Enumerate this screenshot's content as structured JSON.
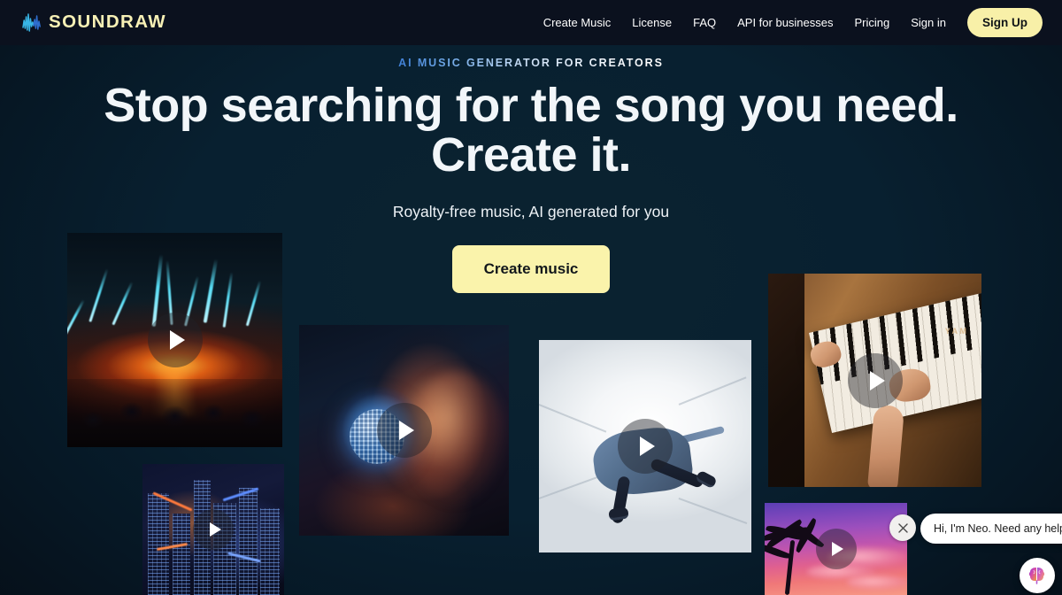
{
  "header": {
    "logo_text": "SOUNDRAW",
    "logo_icon": "waveform-icon",
    "nav": [
      {
        "label": "Create Music"
      },
      {
        "label": "License"
      },
      {
        "label": "FAQ"
      },
      {
        "label": "API for businesses"
      },
      {
        "label": "Pricing"
      },
      {
        "label": "Sign in"
      }
    ],
    "signup_label": "Sign Up",
    "signup_color": "#f8f0a8",
    "bg_color": "#0b111e"
  },
  "hero": {
    "eyebrow": "AI MUSIC GENERATOR FOR CREATORS",
    "headline_line1": "Stop searching for the song you need.",
    "headline_line2": "Create it.",
    "subhead": "Royalty-free music, AI generated for you",
    "cta_label": "Create music",
    "cta_color": "#faf3ab"
  },
  "cards": [
    {
      "name": "concert-laser-show",
      "play_icon": "play-icon"
    },
    {
      "name": "disco-ball-woman",
      "play_icon": "play-icon"
    },
    {
      "name": "breakdancer",
      "play_icon": "play-icon"
    },
    {
      "name": "piano-hands",
      "play_icon": "play-icon"
    },
    {
      "name": "night-cityscape",
      "play_icon": "play-icon"
    },
    {
      "name": "tropical-sunset",
      "play_icon": "play-icon"
    }
  ],
  "piano_brand": "YAM",
  "chat": {
    "message": "Hi, I'm Neo. Need any help?",
    "close_icon": "close-icon",
    "avatar_icon": "brain-icon"
  }
}
